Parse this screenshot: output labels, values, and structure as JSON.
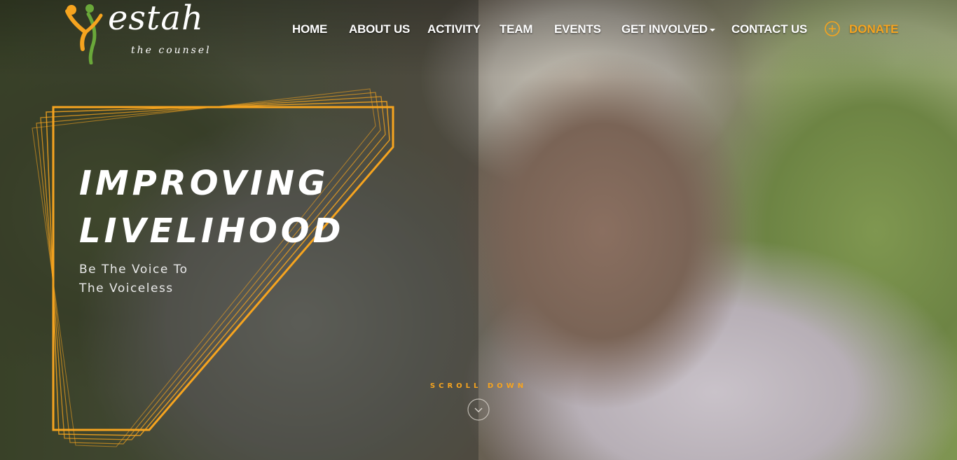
{
  "brand": {
    "name": "estah",
    "tagline": "the counsel"
  },
  "nav": {
    "items": [
      {
        "label": "HOME"
      },
      {
        "label": "ABOUT US"
      },
      {
        "label": "ACTIVITY"
      },
      {
        "label": "TEAM"
      },
      {
        "label": "EVENTS"
      },
      {
        "label": "GET INVOLVED",
        "has_dropdown": true
      },
      {
        "label": "CONTACT US"
      }
    ],
    "donate": {
      "label": "DONATE",
      "icon": "plus-circle-icon"
    }
  },
  "hero": {
    "title_line1": "IMPROVING",
    "title_line2": "LIVELIHOOD",
    "subtitle_line1": "Be The Voice To",
    "subtitle_line2": "The Voiceless"
  },
  "scroll": {
    "label": "SCROLL DOWN",
    "icon": "chevron-down-circle-icon"
  },
  "colors": {
    "accent": "#f6a41f",
    "text": "#ffffff"
  }
}
